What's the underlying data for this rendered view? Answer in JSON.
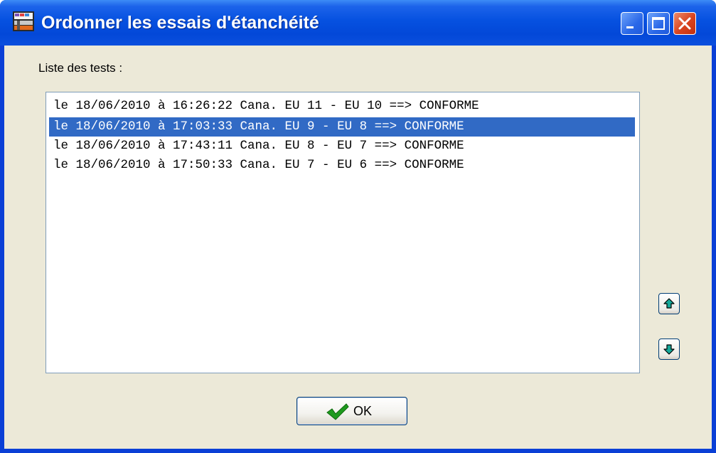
{
  "window": {
    "title": "Ordonner les essais d'étanchéité",
    "app_icon": "app-icon",
    "controls": [
      "minimize-icon",
      "maximize-icon",
      "close-icon"
    ]
  },
  "list": {
    "label": "Liste des tests :",
    "items": [
      "le 18/06/2010 à 16:26:22 Cana. EU 11 - EU 10 ==> CONFORME",
      "le 18/06/2010 à 17:03:33 Cana. EU 9 - EU 8 ==> CONFORME",
      "le 18/06/2010 à 17:43:11 Cana. EU 8 - EU 7 ==> CONFORME",
      "le 18/06/2010 à 17:50:33 Cana. EU 7 - EU 6 ==> CONFORME"
    ],
    "selected_index": 1
  },
  "buttons": {
    "move_up_icon": "arrow-up-icon",
    "move_down_icon": "arrow-down-icon",
    "ok_label": "OK",
    "ok_icon": "checkmark-icon"
  },
  "colors": {
    "titlebar": "#0651e0",
    "dialog_bg": "#ece9d8",
    "selection": "#316ac5",
    "arrow": "#14a89a"
  }
}
